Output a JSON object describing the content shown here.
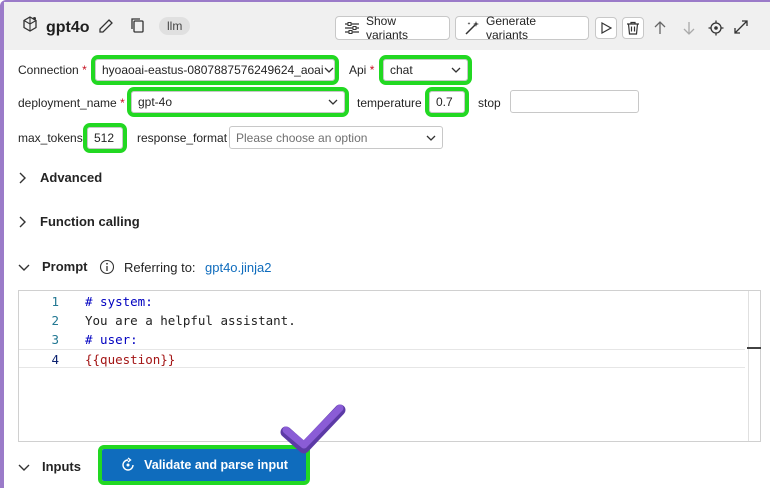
{
  "header": {
    "title": "gpt4o",
    "badge": "llm",
    "show_variants": "Show variants",
    "generate_variants": "Generate variants"
  },
  "form": {
    "connection": {
      "label": "Connection",
      "value": "hyoaoai-eastus-0807887576249624_aoai"
    },
    "api": {
      "label": "Api",
      "value": "chat"
    },
    "deployment_name": {
      "label": "deployment_name",
      "value": "gpt-4o"
    },
    "temperature": {
      "label": "temperature",
      "value": "0.7"
    },
    "stop": {
      "label": "stop",
      "value": ""
    },
    "max_tokens": {
      "label": "max_tokens",
      "value": "512"
    },
    "response_format": {
      "label": "response_format",
      "placeholder": "Please choose an option"
    },
    "required_mark": "*"
  },
  "sections": {
    "advanced": "Advanced",
    "function_calling": "Function calling",
    "prompt": "Prompt",
    "referring_to": "Referring to:",
    "prompt_file": "gpt4o.jinja2",
    "inputs": "Inputs"
  },
  "editor": {
    "lines": [
      {
        "num": "1",
        "text": "# system:"
      },
      {
        "num": "2",
        "text": "You are a helpful assistant."
      },
      {
        "num": "3",
        "text": "# user:"
      },
      {
        "num": "4",
        "text": "{{question}}"
      }
    ]
  },
  "actions": {
    "validate": "Validate and parse input"
  },
  "colors": {
    "highlight": "#22d822",
    "accent": "#0f6cbd",
    "frame": "#9b7bc9",
    "checkmark": "#7b4fc9"
  }
}
